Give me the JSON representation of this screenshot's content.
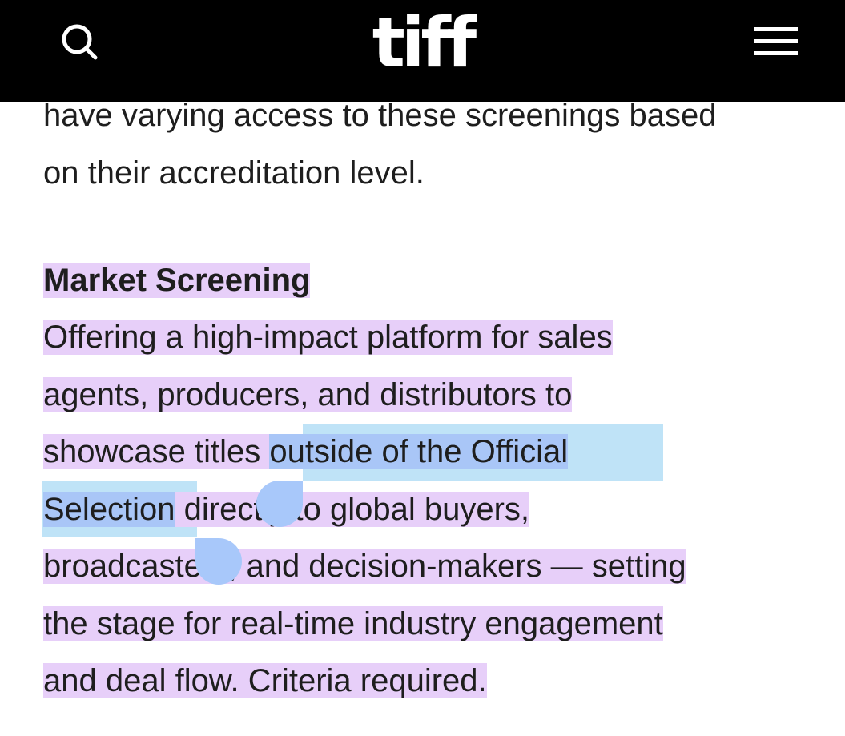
{
  "header": {
    "logo": "tiff",
    "search_icon": "search-icon",
    "menu_icon": "hamburger-menu-icon",
    "background": "#000000"
  },
  "article": {
    "intro_line_1": "have varying access to these screenings based",
    "intro_line_2": "on their accreditation level.",
    "heading": "Market Screening",
    "line_1": "Offering a high-impact platform for sales",
    "line_2": "agents, producers, and distributors to",
    "line_3_before": "showcase titles ",
    "line_3_selected": "outside of the Official",
    "line_4_selected": "Selection",
    "line_4_after": " directly to global buyers,",
    "line_5": "broadcasters, and decision-makers — setting",
    "line_6": "the stage for real-time industry engagement",
    "line_7": "and deal flow. Criteria required."
  },
  "colors": {
    "highlight_purple": "#e7cff9",
    "selection_blue": "#a9c6f7",
    "selection_halo": "#bfe3f7"
  }
}
